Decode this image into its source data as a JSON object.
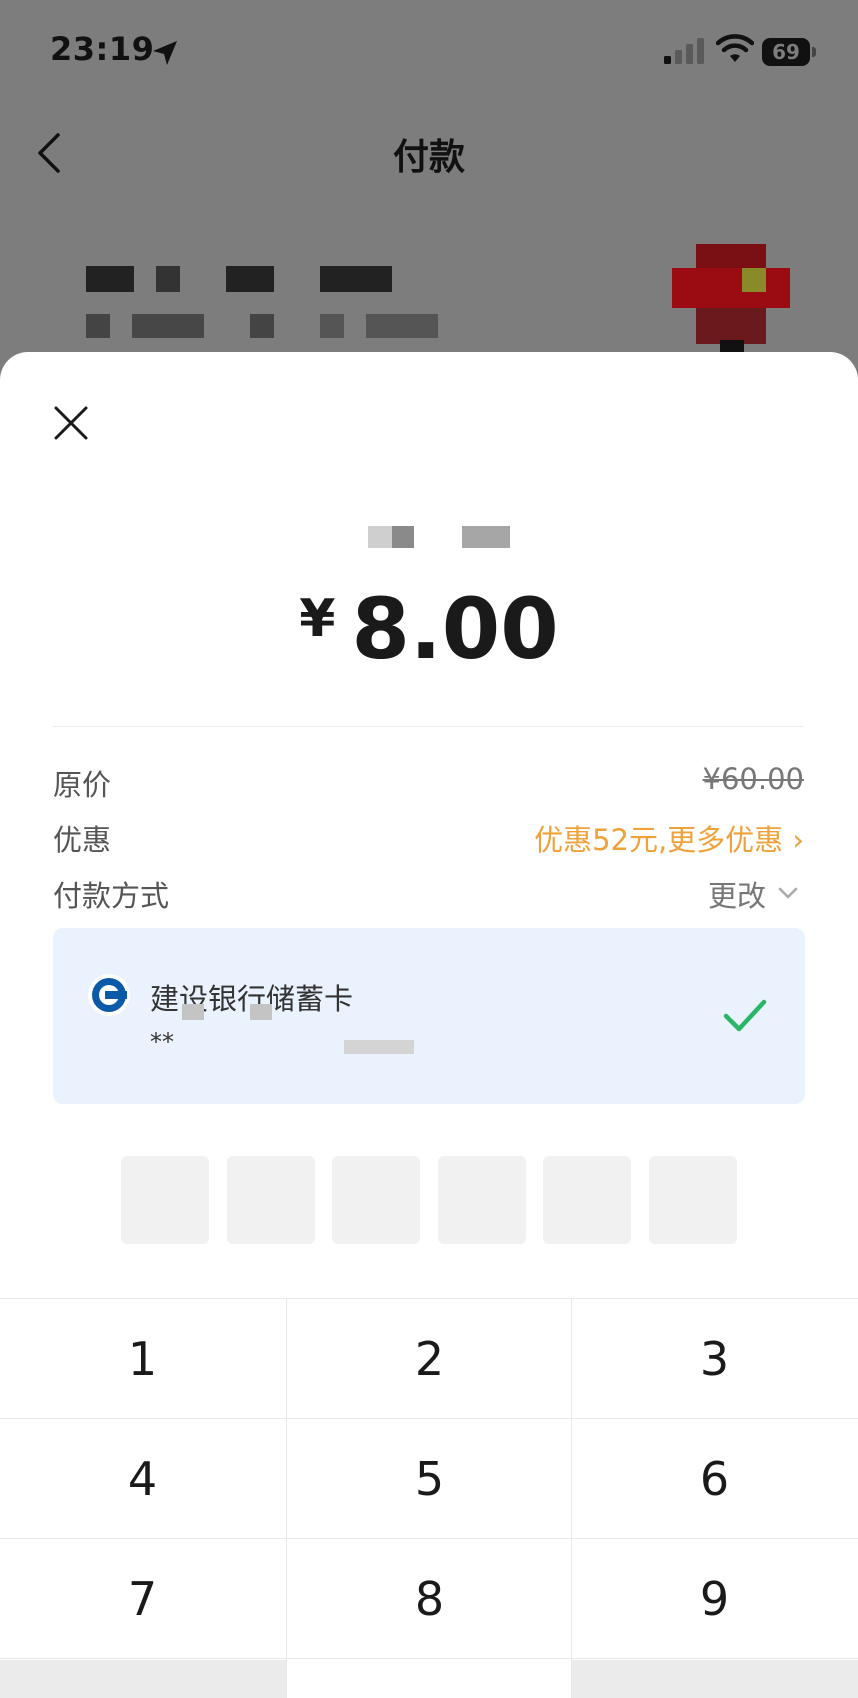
{
  "status_bar": {
    "time": "23:19",
    "battery": "69"
  },
  "nav": {
    "title": "付款"
  },
  "amount": {
    "currency": "¥",
    "value": "8.00"
  },
  "details": {
    "original_price_label": "原价",
    "original_price_value": "¥60.00",
    "discount_label": "优惠",
    "discount_value": "优惠52元,更多优惠 ›",
    "payment_method_label": "付款方式",
    "change_label": "更改"
  },
  "card": {
    "bank_name": "建设银行储蓄卡",
    "masked_number": "**"
  },
  "keypad": {
    "keys": [
      "1",
      "2",
      "3",
      "4",
      "5",
      "6",
      "7",
      "8",
      "9"
    ]
  },
  "colors": {
    "promo": "#f0a23a",
    "check": "#2bb567",
    "card_bg": "#eaf2fd"
  },
  "icons": [
    "location-arrow-icon",
    "signal-icon",
    "wifi-icon",
    "battery-icon",
    "back-chevron-icon",
    "close-icon",
    "ccb-bank-icon",
    "checkmark-icon",
    "chevron-down-icon"
  ]
}
